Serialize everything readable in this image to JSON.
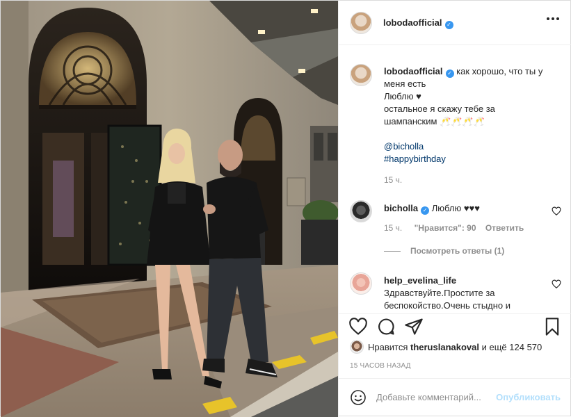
{
  "post": {
    "photo_alt": "",
    "author": {
      "username": "lobodaofficial",
      "verified": true
    },
    "header": {
      "more_icon": "more-horizontal-icon"
    },
    "caption": {
      "username": "lobodaofficial",
      "line1": "как хорошо, что ты у меня есть",
      "line2": "Люблю ♥",
      "line3": "остальное я скажу тебе за шампанским 🥂🥂🥂🥂",
      "mention": "@bicholla",
      "hashtag": "#happybirthday",
      "time": "15 ч."
    },
    "comments": [
      {
        "username": "bicholla",
        "verified": true,
        "text": "Люблю ♥♥♥",
        "time": "15 ч.",
        "likes_label": "\"Нравится\": 90",
        "reply_label": "Ответить",
        "view_replies": "Посмотреть ответы (1)"
      },
      {
        "username": "help_evelina_life",
        "verified": false,
        "text": "Здравствуйте.Простите за беспокойство.Очень стыдно и"
      }
    ],
    "likes": {
      "prefix": "Нравится",
      "user": "theruslanakoval",
      "suffix": "и ещё 124 570"
    },
    "timestamp": "15 ЧАСОВ НАЗАД",
    "add_comment": {
      "placeholder": "Добавьте комментарий...",
      "publish_label": "Опубликовать"
    },
    "colors": {
      "verified": "#3897f0",
      "link": "#00376b",
      "publish_disabled": "#b2dffc",
      "muted": "#8e8e8e"
    }
  }
}
